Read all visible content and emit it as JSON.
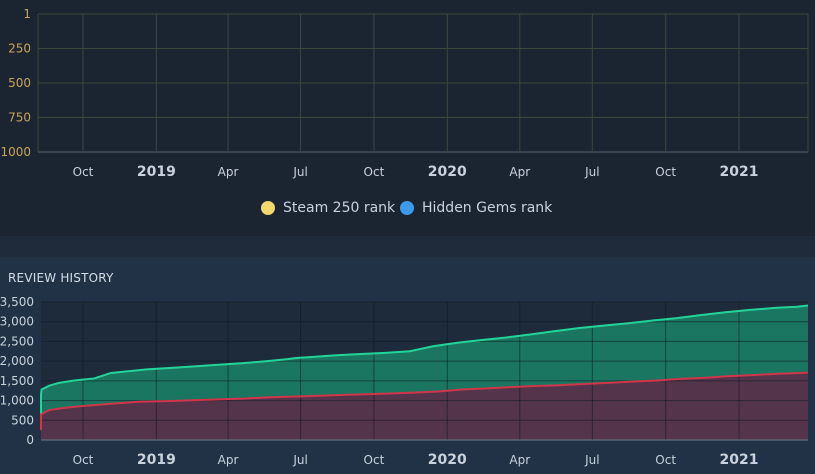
{
  "rank_chart": {
    "y_ticks": [
      "1",
      "250",
      "500",
      "750",
      "1000"
    ],
    "x_ticks": [
      {
        "label": "Oct",
        "date": "2018-10-01",
        "bold": false
      },
      {
        "label": "2019",
        "date": "2019-01-01",
        "bold": true
      },
      {
        "label": "Apr",
        "date": "2019-04-01",
        "bold": false
      },
      {
        "label": "Jul",
        "date": "2019-07-01",
        "bold": false
      },
      {
        "label": "Oct",
        "date": "2019-10-01",
        "bold": false
      },
      {
        "label": "2020",
        "date": "2020-01-01",
        "bold": true
      },
      {
        "label": "Apr",
        "date": "2020-04-01",
        "bold": false
      },
      {
        "label": "Jul",
        "date": "2020-07-01",
        "bold": false
      },
      {
        "label": "Oct",
        "date": "2020-10-01",
        "bold": false
      },
      {
        "label": "2021",
        "date": "2021-01-01",
        "bold": true
      }
    ],
    "legend": [
      {
        "label": "Steam 250 rank",
        "color": "#f1d96e"
      },
      {
        "label": "Hidden Gems rank",
        "color": "#3d9be9"
      }
    ]
  },
  "review_section": {
    "title": "REVIEW HISTORY"
  },
  "chart_data": [
    {
      "type": "line",
      "title": "",
      "y_ticks": [
        "1",
        "250",
        "500",
        "750",
        "1000"
      ],
      "ylim": [
        1,
        1000
      ],
      "y_reversed": true,
      "series": [
        {
          "name": "Steam 250 rank",
          "color": "#f1d96e",
          "values": []
        },
        {
          "name": "Hidden Gems rank",
          "color": "#3d9be9",
          "values": []
        }
      ],
      "grid": true,
      "legend": "bottom"
    },
    {
      "type": "area",
      "title": "REVIEW HISTORY",
      "ylim": [
        0,
        3500
      ],
      "y_ticks": [
        "0",
        "500",
        "1,000",
        "1,500",
        "2,000",
        "2,500",
        "3,000",
        "3,500"
      ],
      "x_ticks": [
        "Oct",
        "2019",
        "Apr",
        "Jul",
        "Oct",
        "2020",
        "Apr",
        "Jul",
        "Oct",
        "2021"
      ],
      "grid": true,
      "series": [
        {
          "color": "#1a7a62",
          "line_color": "#22d49a",
          "x": [
            "2018-07-28",
            "2018-08-03",
            "2018-08-10",
            "2018-08-20",
            "2018-09-01",
            "2018-09-20",
            "2018-10-15",
            "2018-11-05",
            "2018-11-25",
            "2018-12-20",
            "2019-01-20",
            "2019-02-20",
            "2019-03-20",
            "2019-04-20",
            "2019-05-20",
            "2019-06-15",
            "2019-06-25",
            "2019-07-10",
            "2019-08-15",
            "2019-09-15",
            "2019-10-15",
            "2019-11-15",
            "2019-12-15",
            "2020-01-15",
            "2020-02-15",
            "2020-03-15",
            "2020-04-15",
            "2020-05-15",
            "2020-06-15",
            "2020-07-15",
            "2020-08-15",
            "2020-09-15",
            "2020-10-15",
            "2020-11-15",
            "2020-12-15",
            "2021-01-15",
            "2021-02-15",
            "2021-03-15",
            "2021-04-01"
          ],
          "values": [
            600,
            1150,
            1280,
            1380,
            1450,
            1510,
            1560,
            1700,
            1740,
            1790,
            1830,
            1870,
            1910,
            1950,
            2000,
            2050,
            2080,
            2100,
            2150,
            2180,
            2210,
            2250,
            2380,
            2470,
            2540,
            2600,
            2680,
            2760,
            2840,
            2900,
            2960,
            3030,
            3090,
            3170,
            3240,
            3300,
            3350,
            3380,
            3410
          ]
        },
        {
          "color": "#56304a",
          "line_color": "#d0354a",
          "x": [
            "2018-07-28",
            "2018-08-05",
            "2018-08-20",
            "2018-09-10",
            "2018-10-05",
            "2018-11-05",
            "2018-12-10",
            "2019-01-20",
            "2019-02-20",
            "2019-03-20",
            "2019-04-20",
            "2019-05-20",
            "2019-06-20",
            "2019-07-20",
            "2019-08-20",
            "2019-09-20",
            "2019-10-20",
            "2019-11-20",
            "2019-12-20",
            "2020-01-20",
            "2020-02-20",
            "2020-03-20",
            "2020-04-20",
            "2020-05-20",
            "2020-06-20",
            "2020-07-20",
            "2020-08-20",
            "2020-09-20",
            "2020-10-20",
            "2020-11-20",
            "2020-12-20",
            "2021-01-20",
            "2021-02-20",
            "2021-03-20",
            "2021-04-01"
          ],
          "values": [
            250,
            650,
            760,
            820,
            870,
            920,
            970,
            990,
            1010,
            1030,
            1050,
            1080,
            1100,
            1120,
            1140,
            1160,
            1180,
            1200,
            1230,
            1280,
            1310,
            1340,
            1370,
            1390,
            1420,
            1450,
            1480,
            1510,
            1550,
            1580,
            1620,
            1650,
            1680,
            1700,
            1710
          ]
        }
      ]
    }
  ]
}
